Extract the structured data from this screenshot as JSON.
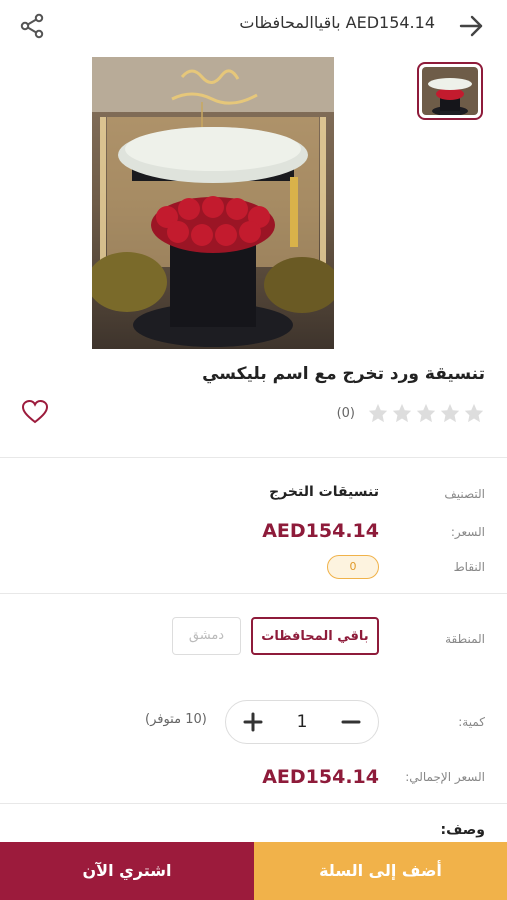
{
  "header": {
    "title": "باقياالمحافظات AED154.14",
    "share_icon": "share-icon",
    "back_icon": "arrow-right-icon"
  },
  "product": {
    "name": "تنسيقة ورد تخرج مع اسم بليكسي",
    "rating_stars_filled": 0,
    "rating_stars_total": 5,
    "rating_count": "(0)",
    "favorite_icon": "heart-icon"
  },
  "details": {
    "category_label": "التصنيف",
    "category_value": "تنسيقات التخرج",
    "price_label": "السعر:",
    "price_value": "AED154.14",
    "points_label": "النقاط",
    "points_value": "0",
    "region_label": "المنطقة",
    "region_options": [
      "باقي المحافظات",
      "دمشق"
    ],
    "region_selected": "باقي المحافظات",
    "quantity_label": "كمية:",
    "quantity_value": "1",
    "availability": "(10 متوفر)",
    "total_label": "السعر الإجمالي:",
    "total_value": "AED154.14",
    "description_label": "وصف:"
  },
  "actions": {
    "buy_now": "اشتري الآن",
    "add_to_cart": "أضف إلى السلة"
  },
  "colors": {
    "brand": "#9c1b3c",
    "accent": "#f1b24a",
    "star_empty": "#dddddd"
  }
}
